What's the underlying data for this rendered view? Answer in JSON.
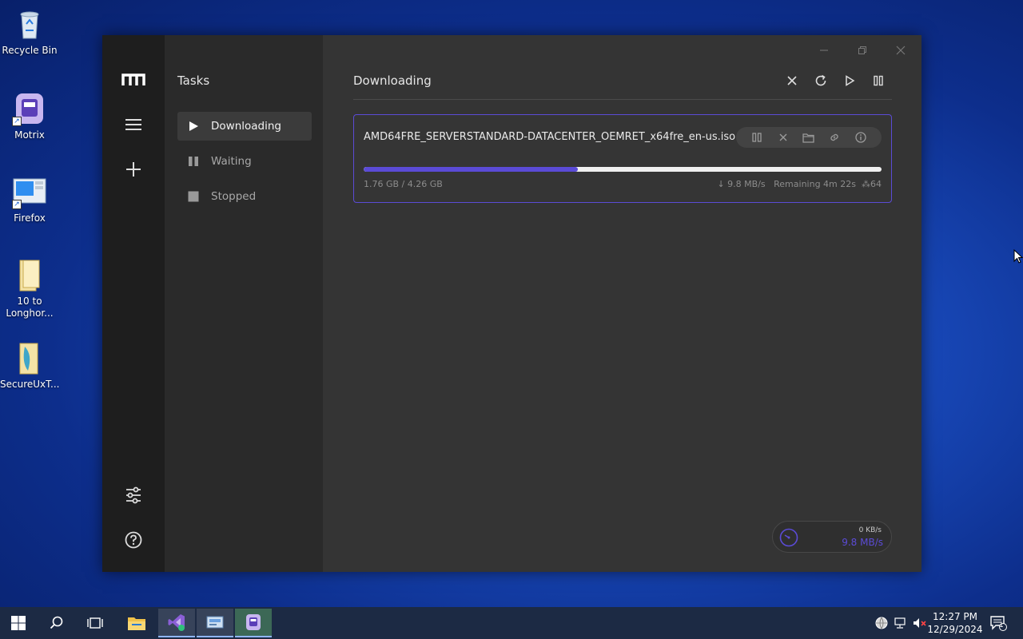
{
  "desktop": {
    "icons": [
      {
        "label": "Recycle Bin"
      },
      {
        "label": "Motrix"
      },
      {
        "label": "Firefox"
      },
      {
        "label": "10 to Longhor..."
      },
      {
        "label": "SecureUxT..."
      }
    ]
  },
  "app": {
    "rail": {
      "logo": "motrix-logo",
      "items": [
        "menu-icon",
        "add-icon"
      ],
      "bottom": [
        "settings-icon",
        "help-icon"
      ]
    },
    "sidebar": {
      "title": "Tasks",
      "items": [
        {
          "label": "Downloading",
          "icon": "play-icon",
          "active": true
        },
        {
          "label": "Waiting",
          "icon": "pause-icon",
          "active": false
        },
        {
          "label": "Stopped",
          "icon": "stop-icon",
          "active": false
        }
      ]
    },
    "main": {
      "title": "Downloading",
      "toolbar": [
        "close-icon",
        "refresh-icon",
        "resume-all-icon",
        "pause-all-icon"
      ],
      "task": {
        "name": "AMD64FRE_SERVERSTANDARD-DATACENTER_OEMRET_x64fre_en-us.iso",
        "progress_percent": 41.3,
        "size": "1.76 GB / 4.26 GB",
        "speed": "↓ 9.8 MB/s",
        "remaining": "Remaining 4m 22s",
        "connections": "64",
        "actions": [
          "pause-icon",
          "delete-icon",
          "folder-icon",
          "link-icon",
          "info-icon"
        ]
      },
      "speed_meter": {
        "upload": "0 KB/s",
        "download": "9.8 MB/s"
      }
    },
    "colors": {
      "accent": "#5b4bd6",
      "bg": "#343434",
      "rail": "#1e1e1e",
      "sidebar": "#2a2a2a"
    }
  },
  "taskbar": {
    "time": "12:27 PM",
    "date": "12/29/2024",
    "notification_count": "1"
  }
}
